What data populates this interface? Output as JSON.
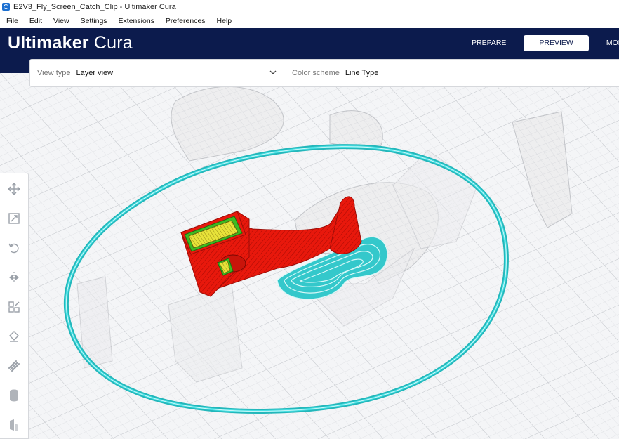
{
  "window": {
    "title": "E2V3_Fly_Screen_Catch_Clip - Ultimaker Cura"
  },
  "menu": [
    {
      "label": "File"
    },
    {
      "label": "Edit"
    },
    {
      "label": "View"
    },
    {
      "label": "Settings"
    },
    {
      "label": "Extensions"
    },
    {
      "label": "Preferences"
    },
    {
      "label": "Help"
    }
  ],
  "header": {
    "brand": "Ultimaker",
    "product": "Cura",
    "tabs": [
      {
        "label": "PREPARE"
      },
      {
        "label": "PREVIEW",
        "active": true
      },
      {
        "label": "MON"
      }
    ]
  },
  "view_options": {
    "view_type_label": "View type",
    "view_type_value": "Layer view",
    "color_scheme_label": "Color scheme",
    "color_scheme_value": "Line Type"
  },
  "toolbar": {
    "tools": [
      "move-icon",
      "scale-icon",
      "rotate-icon",
      "mirror-icon",
      "per-model-settings-icon",
      "support-blocker-icon",
      "custom-supports-icon",
      "cylinder-icon",
      "mesh-tools-icon"
    ]
  },
  "colors": {
    "header_bg": "#0c1b4d",
    "skirt": "#3dd6d9",
    "wall": "#e8180c",
    "infill": "#e8e33a",
    "inner_wall": "#3dbb22"
  }
}
